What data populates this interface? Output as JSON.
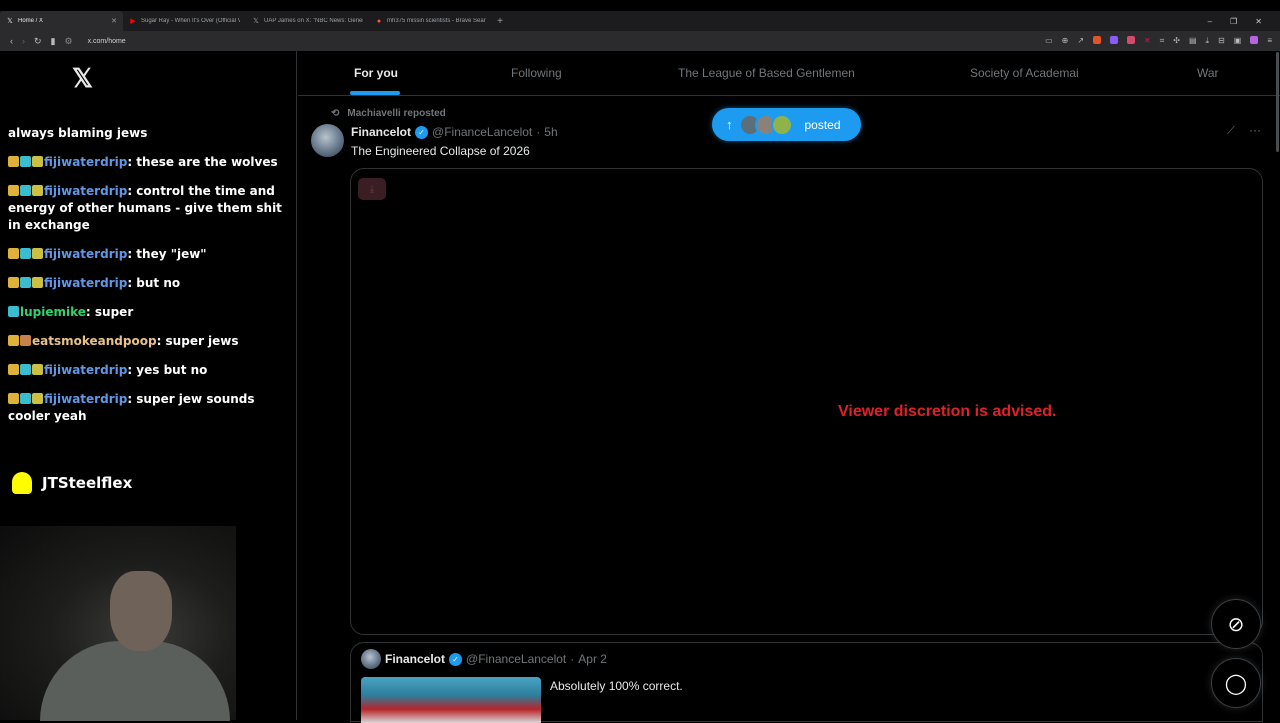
{
  "browser": {
    "tabs": [
      {
        "title": "Home / X",
        "icon": "x-logo-icon",
        "active": true
      },
      {
        "title": "Sugar Ray - When It's Over (Official V",
        "icon": "youtube-icon",
        "active": false
      },
      {
        "title": "UAP James on X: \"NBC News: Gener",
        "icon": "x-logo-icon",
        "active": false
      },
      {
        "title": "mh375 missin scientists - Brave Searc",
        "icon": "brave-search-icon",
        "active": false
      }
    ],
    "url": "x.com/home"
  },
  "left": {
    "chat": [
      {
        "user": "",
        "text": "always blaming jews",
        "badges": [],
        "user_color": ""
      },
      {
        "user": "fijiwaterdrip",
        "text": ": these are the wolves",
        "badges": [
          "gold",
          "teal",
          "yellow"
        ],
        "user_color": "blue"
      },
      {
        "user": "fijiwaterdrip",
        "text": ": control the time and energy of other humans - give them shit in exchange",
        "badges": [
          "gold",
          "teal",
          "yellow"
        ],
        "user_color": "blue"
      },
      {
        "user": "fijiwaterdrip",
        "text": ": they \"jew\"",
        "badges": [
          "gold",
          "teal",
          "yellow"
        ],
        "user_color": "blue"
      },
      {
        "user": "fijiwaterdrip",
        "text": ": but no",
        "badges": [
          "gold",
          "teal",
          "yellow"
        ],
        "user_color": "blue"
      },
      {
        "user": "lupiemike",
        "text": ": super",
        "badges": [
          "teal"
        ],
        "user_color": "green"
      },
      {
        "user": "eatsmokeandpoop",
        "text": ": super jews",
        "badges": [
          "gold",
          "orange"
        ],
        "user_color": "tan"
      },
      {
        "user": "fijiwaterdrip",
        "text": ": yes but no",
        "badges": [
          "gold",
          "teal",
          "yellow"
        ],
        "user_color": "blue"
      },
      {
        "user": "fijiwaterdrip",
        "text": ": super jew sounds cooler yeah",
        "badges": [
          "gold",
          "teal",
          "yellow"
        ],
        "user_color": "blue"
      }
    ],
    "snapchat_name": "JTSteelflex"
  },
  "feed": {
    "tabs": [
      "For you",
      "Following",
      "The League of Based Gentlemen",
      "Society of Academai",
      "War"
    ],
    "repost_label": "Machiavelli reposted",
    "post": {
      "name": "Financelot",
      "handle": "@FinanceLancelot",
      "time": "5h",
      "text": "The Engineered Collapse of 2026",
      "warning": "Viewer discretion is advised."
    },
    "posted_pill_label": "posted",
    "quote": {
      "name": "Financelot",
      "handle": "@FinanceLancelot",
      "date": "Apr 2",
      "text": "Absolutely 100% correct."
    }
  },
  "colors": {
    "accent": "#1d9bf0",
    "warning": "#e0202a",
    "background": "#000000"
  }
}
